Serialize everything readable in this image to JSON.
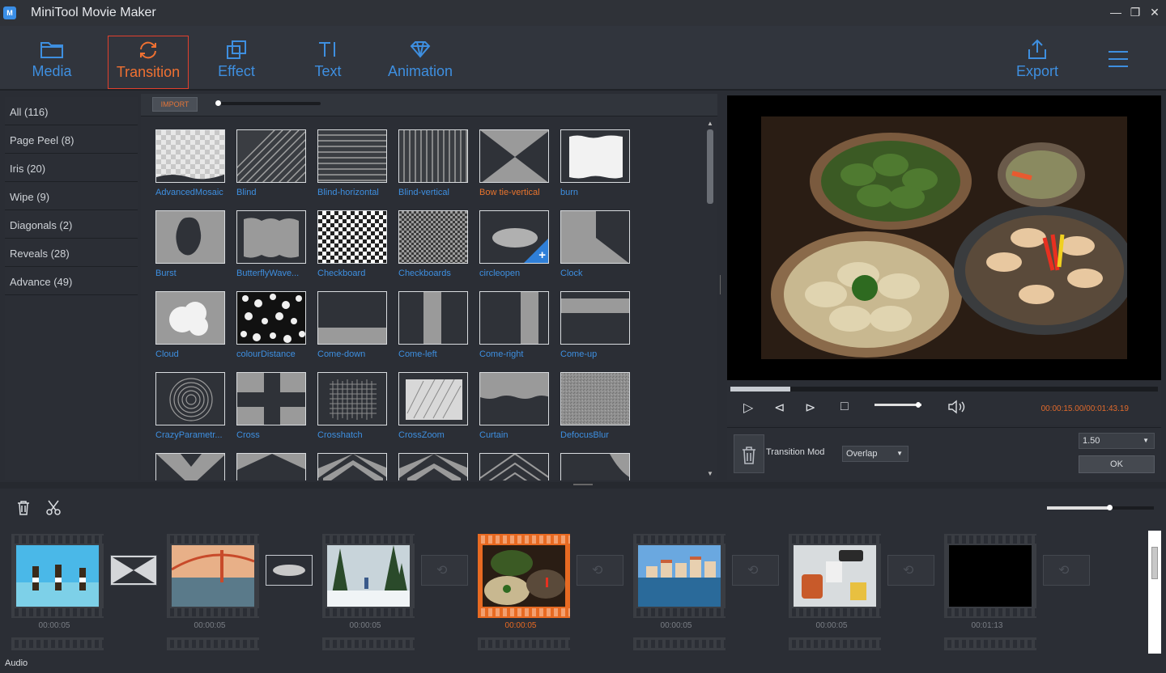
{
  "app": {
    "title": "MiniTool Movie Maker",
    "logo": "M"
  },
  "window_controls": [
    "—",
    "❐",
    "✕"
  ],
  "toolbar": {
    "items": [
      {
        "label": "Media",
        "icon": "folder-icon",
        "active": false
      },
      {
        "label": "Transition",
        "icon": "transition-icon",
        "active": true
      },
      {
        "label": "Effect",
        "icon": "effect-icon",
        "active": false
      },
      {
        "label": "Text",
        "icon": "text-icon",
        "active": false
      },
      {
        "label": "Animation",
        "icon": "diamond-icon",
        "active": false
      }
    ],
    "export_label": "Export",
    "menu_icon": "hamburger-icon"
  },
  "categories": [
    "All (116)",
    "Page Peel (8)",
    "Iris (20)",
    "Wipe (9)",
    "Diagonals (2)",
    "Reveals (28)",
    "Advance (49)"
  ],
  "library": {
    "import_label": "IMPORT",
    "transitions": [
      "AdvancedMosaic",
      "Blind",
      "Blind-horizontal",
      "Blind-vertical",
      "Bow tie-vertical",
      "burn",
      "Burst",
      "ButterflyWave...",
      "Checkboard",
      "Checkboards",
      "circleopen",
      "Clock",
      "Cloud",
      "colourDistance",
      "Come-down",
      "Come-left",
      "Come-right",
      "Come-up",
      "CrazyParametr...",
      "Cross",
      "Crosshatch",
      "CrossZoom",
      "Curtain",
      "DefocusBlur"
    ],
    "selected_transition": "Bow tie-vertical"
  },
  "player": {
    "timecode": "00:00:15.00/00:01:43.19",
    "progress": 0.14,
    "volume": 0.93
  },
  "transition_settings": {
    "mode_label": "Transition Mod",
    "mode_value": "Overlap",
    "duration_value": "1.50",
    "ok_label": "OK"
  },
  "timeline": {
    "clips": [
      {
        "duration": "00:00:05",
        "selected": false
      },
      {
        "duration": "00:00:05",
        "selected": false
      },
      {
        "duration": "00:00:05",
        "selected": false
      },
      {
        "duration": "00:00:05",
        "selected": true
      },
      {
        "duration": "00:00:05",
        "selected": false
      },
      {
        "duration": "00:00:05",
        "selected": false
      },
      {
        "duration": "00:01:13",
        "selected": false
      }
    ],
    "zoom": 0.58,
    "audio_label": "Audio"
  }
}
